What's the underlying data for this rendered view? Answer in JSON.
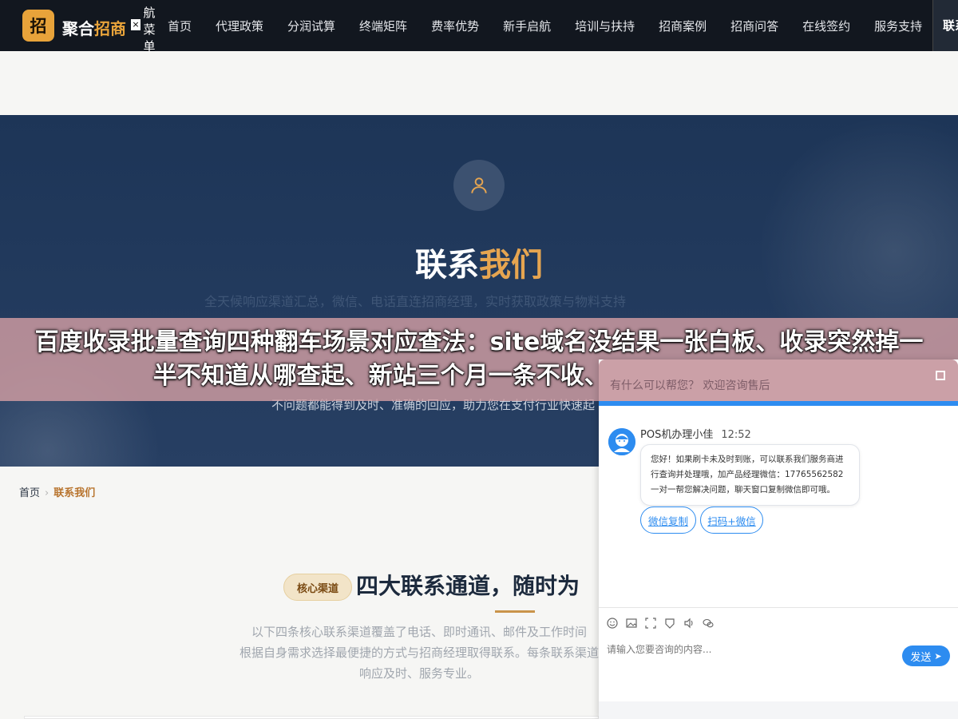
{
  "brand": {
    "badge": "招",
    "name_part1": "聚合",
    "name_part2": "招商"
  },
  "menu_close": "×",
  "vertical_menu_label": "航\n菜\n单",
  "nav": {
    "items": [
      "首页",
      "代理政策",
      "分润试算",
      "终端矩阵",
      "费率优势",
      "新手启航",
      "培训与扶持",
      "招商案例",
      "招商问答",
      "在线签约",
      "服务支持"
    ],
    "partial_item": "联系"
  },
  "hero": {
    "title_part1": "联系",
    "title_part2": "我们",
    "subtitle": "全天候响应渠道汇总，微信、电话直连招商经理，实时获取政策与物料支持",
    "bottom_line": "不问题都能得到及时、准确的回应，助力您在支付行业快速起"
  },
  "headline": "百度收录批量查询四种翻车场景对应查法：site域名没结果一张白板、收录突然掉一半不知道从哪查起、新站三个月一条不收、几千个URL一条条",
  "breadcrumb": {
    "home": "首页",
    "separator": "›",
    "current": "联系我们"
  },
  "section": {
    "pill": "核心渠道",
    "title": "四大联系通道，随时为",
    "desc": [
      "以下四条核心联系渠道覆盖了电话、即时通讯、邮件及工作时间",
      "根据自身需求选择最便捷的方式与招商经理取得联系。每条联系渠道",
      "响应及时、服务专业。"
    ]
  },
  "chat": {
    "header_title": "有什么可以帮您？ 欢迎咨询售后",
    "agent_name": "POS机办理小佳",
    "time": "12:52",
    "message": "您好！如果刷卡未及时到账，可以联系我们服务商进行查询并处理哦，加产品经理微信：17765562582 一对一帮您解决问题，聊天窗口复制微信即可哦。",
    "buttons": [
      "微信复制",
      "扫码+微信"
    ],
    "input_placeholder": "请输入您要咨询的内容...",
    "send_label": "发送",
    "toolbar_icons": [
      "emoji-icon",
      "image-icon",
      "screenshot-icon",
      "rating-icon",
      "voice-icon",
      "wechat-icon"
    ],
    "accent_color": "#2d8cf0"
  },
  "colors": {
    "nav_bg": "#12171f",
    "gold": "#e8a33a",
    "hero_bg": "#1d3557"
  }
}
